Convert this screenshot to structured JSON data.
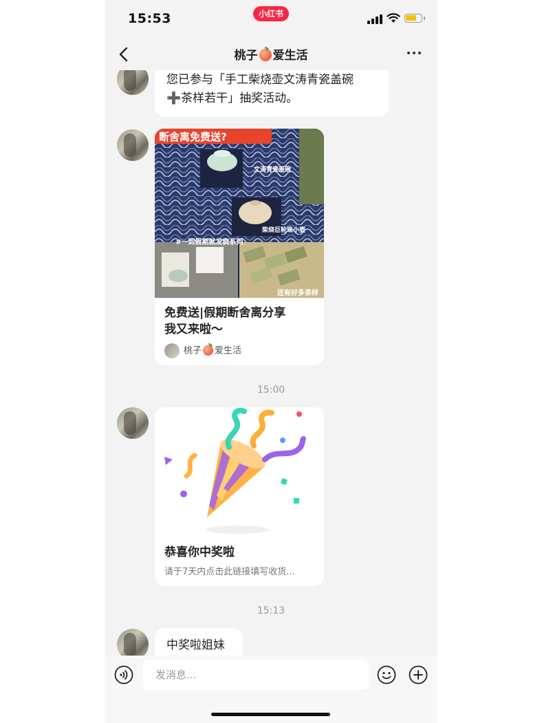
{
  "status": {
    "time": "15:53",
    "app_badge": "小红书"
  },
  "header": {
    "title_prefix": "桃子",
    "title_suffix": "爱生活"
  },
  "messages": {
    "lottery_text_line1": "您已参与「手工柴烧壶文涛青瓷盖碗",
    "lottery_text_line2": "➕茶样若干」抽奖活动。",
    "note_card": {
      "banner": "断舍离免费送?",
      "label_cup": "文涛青瓷盖碗",
      "label_pot": "柴烧巨轮珠小壶",
      "label_series": "#一到假期就发疯系列",
      "label_more": "还有好多茶样",
      "title_line1": "免费送|假期断舍离分享",
      "title_line2": "我又来啦～",
      "author_prefix": "桃子",
      "author_suffix": "爱生活"
    },
    "time1": "15:00",
    "prize_card": {
      "title": "恭喜你中奖啦",
      "desc": "请于7天内点击此链接填写收货..."
    },
    "time2": "15:13",
    "last_text": "中奖啦姐妹"
  },
  "input": {
    "placeholder": "发消息..."
  },
  "icons": {
    "back": "chevron-left-icon",
    "more": "more-dots-icon",
    "voice": "voice-icon",
    "emoji": "emoji-icon",
    "plus": "plus-icon"
  },
  "colors": {
    "brand": "#ff2442",
    "background": "#f3f3f3",
    "bubble": "#ffffff"
  }
}
